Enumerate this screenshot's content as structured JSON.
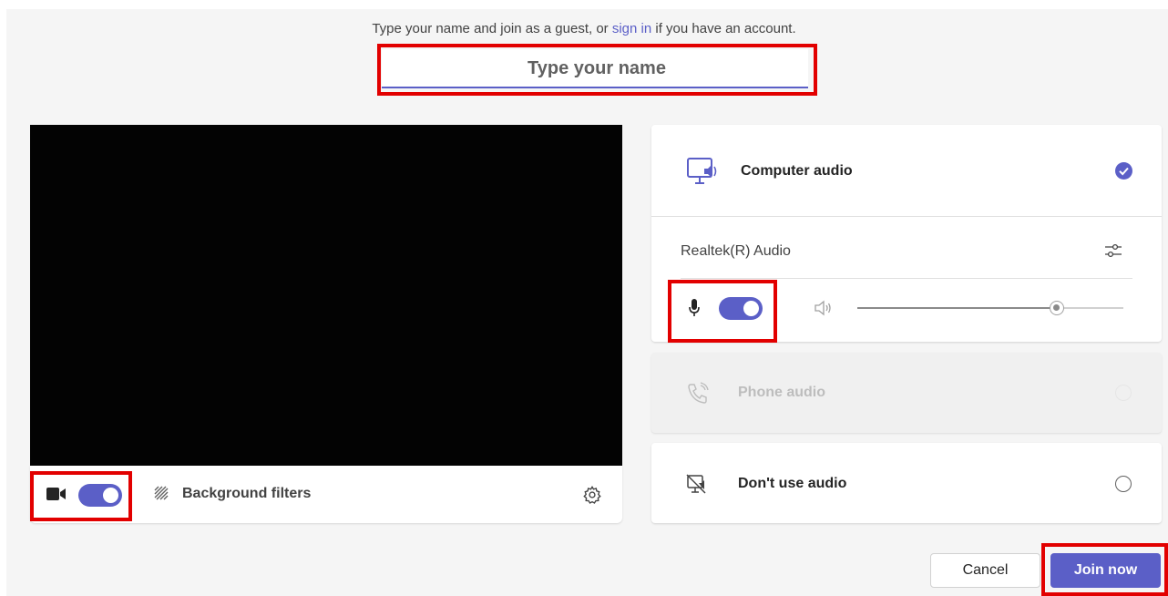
{
  "intro": {
    "before": "Type your name and join as a guest, or ",
    "sign_in_link": "sign in",
    "after": " if you have an account."
  },
  "name_input": {
    "placeholder": "Type your name",
    "value": ""
  },
  "video": {
    "camera_on": true,
    "background_filters_label": "Background filters"
  },
  "audio": {
    "computer_audio_label": "Computer audio",
    "computer_audio_selected": true,
    "device_name": "Realtek(R) Audio",
    "mic_on": true,
    "volume_fraction": 0.75,
    "phone_audio_label": "Phone audio",
    "phone_audio_enabled": false,
    "no_audio_label": "Don't use audio",
    "no_audio_selected": false
  },
  "actions": {
    "cancel_label": "Cancel",
    "join_label": "Join now"
  },
  "colors": {
    "accent": "#5b5fc7",
    "highlight": "#e20000"
  }
}
